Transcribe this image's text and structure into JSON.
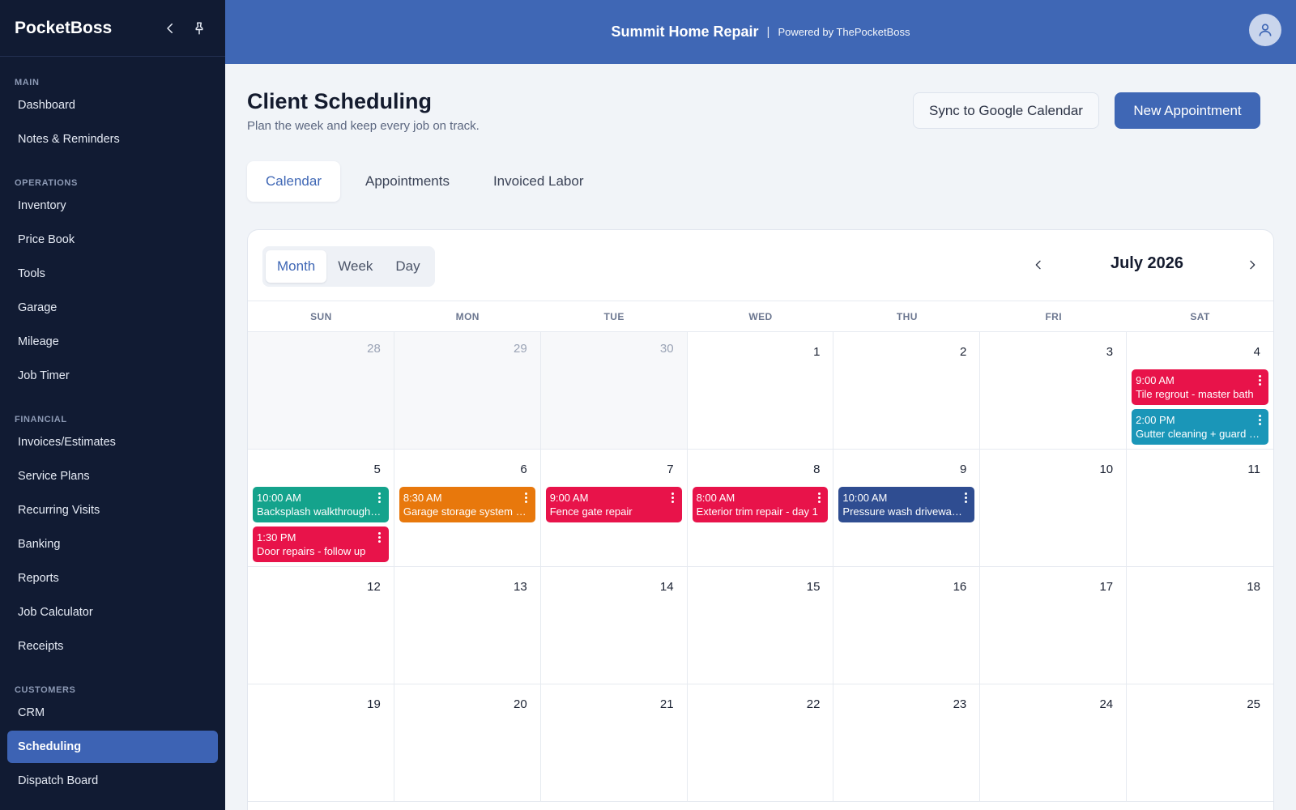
{
  "sidebar": {
    "brand": "PocketBoss",
    "sections": [
      {
        "title": "MAIN",
        "items": [
          {
            "label": "Dashboard"
          },
          {
            "label": "Notes & Reminders"
          }
        ]
      },
      {
        "title": "OPERATIONS",
        "items": [
          {
            "label": "Inventory"
          },
          {
            "label": "Price Book"
          },
          {
            "label": "Tools"
          },
          {
            "label": "Garage"
          },
          {
            "label": "Mileage"
          },
          {
            "label": "Job Timer"
          }
        ]
      },
      {
        "title": "FINANCIAL",
        "items": [
          {
            "label": "Invoices/Estimates"
          },
          {
            "label": "Service Plans"
          },
          {
            "label": "Recurring Visits"
          },
          {
            "label": "Banking"
          },
          {
            "label": "Reports"
          },
          {
            "label": "Job Calculator"
          },
          {
            "label": "Receipts"
          }
        ]
      },
      {
        "title": "CUSTOMERS",
        "items": [
          {
            "label": "CRM"
          },
          {
            "label": "Scheduling",
            "active": true
          },
          {
            "label": "Dispatch Board"
          }
        ]
      }
    ]
  },
  "topbar": {
    "company": "Summit Home Repair",
    "separator": "|",
    "powered": "Powered by ThePocketBoss"
  },
  "header": {
    "title": "Client Scheduling",
    "subtitle": "Plan the week and keep every job on track.",
    "sync_label": "Sync to Google Calendar",
    "new_label": "New Appointment"
  },
  "tabs": [
    {
      "label": "Calendar",
      "active": true
    },
    {
      "label": "Appointments"
    },
    {
      "label": "Invoiced Labor"
    }
  ],
  "calendar": {
    "views": [
      {
        "label": "Month",
        "active": true
      },
      {
        "label": "Week"
      },
      {
        "label": "Day"
      }
    ],
    "month_label": "July 2026",
    "weekdays": [
      "SUN",
      "MON",
      "TUE",
      "WED",
      "THU",
      "FRI",
      "SAT"
    ],
    "colors": {
      "red": "#e8134a",
      "teal": "#14a38c",
      "orange": "#e8780c",
      "cyan": "#1a96b8",
      "navy": "#2f4d91"
    },
    "days": [
      {
        "num": "28",
        "muted": true,
        "events": []
      },
      {
        "num": "29",
        "muted": true,
        "events": []
      },
      {
        "num": "30",
        "muted": true,
        "events": []
      },
      {
        "num": "1",
        "events": []
      },
      {
        "num": "2",
        "events": []
      },
      {
        "num": "3",
        "events": []
      },
      {
        "num": "4",
        "events": [
          {
            "time": "9:00 AM",
            "title": "Tile regrout - master bath",
            "color": "#e8134a"
          },
          {
            "time": "2:00 PM",
            "title": "Gutter cleaning + guard install",
            "color": "#1a96b8"
          }
        ]
      },
      {
        "num": "5",
        "events": [
          {
            "time": "10:00 AM",
            "title": "Backsplash walkthrough and estimate",
            "color": "#14a38c"
          },
          {
            "time": "1:30 PM",
            "title": "Door repairs - follow up",
            "color": "#e8134a"
          }
        ]
      },
      {
        "num": "6",
        "events": [
          {
            "time": "8:30 AM",
            "title": "Garage storage system install",
            "color": "#e8780c"
          }
        ]
      },
      {
        "num": "7",
        "events": [
          {
            "time": "9:00 AM",
            "title": "Fence gate repair",
            "color": "#e8134a"
          }
        ]
      },
      {
        "num": "8",
        "events": [
          {
            "time": "8:00 AM",
            "title": "Exterior trim repair - day 1",
            "color": "#e8134a"
          }
        ]
      },
      {
        "num": "9",
        "events": [
          {
            "time": "10:00 AM",
            "title": "Pressure wash driveway and patio",
            "color": "#2f4d91"
          }
        ]
      },
      {
        "num": "10",
        "events": []
      },
      {
        "num": "11",
        "events": []
      },
      {
        "num": "12",
        "events": []
      },
      {
        "num": "13",
        "events": []
      },
      {
        "num": "14",
        "events": []
      },
      {
        "num": "15",
        "events": []
      },
      {
        "num": "16",
        "events": []
      },
      {
        "num": "17",
        "events": []
      },
      {
        "num": "18",
        "events": []
      },
      {
        "num": "19",
        "events": []
      },
      {
        "num": "20",
        "events": []
      },
      {
        "num": "21",
        "events": []
      },
      {
        "num": "22",
        "events": []
      },
      {
        "num": "23",
        "events": []
      },
      {
        "num": "24",
        "events": []
      },
      {
        "num": "25",
        "events": []
      }
    ]
  }
}
